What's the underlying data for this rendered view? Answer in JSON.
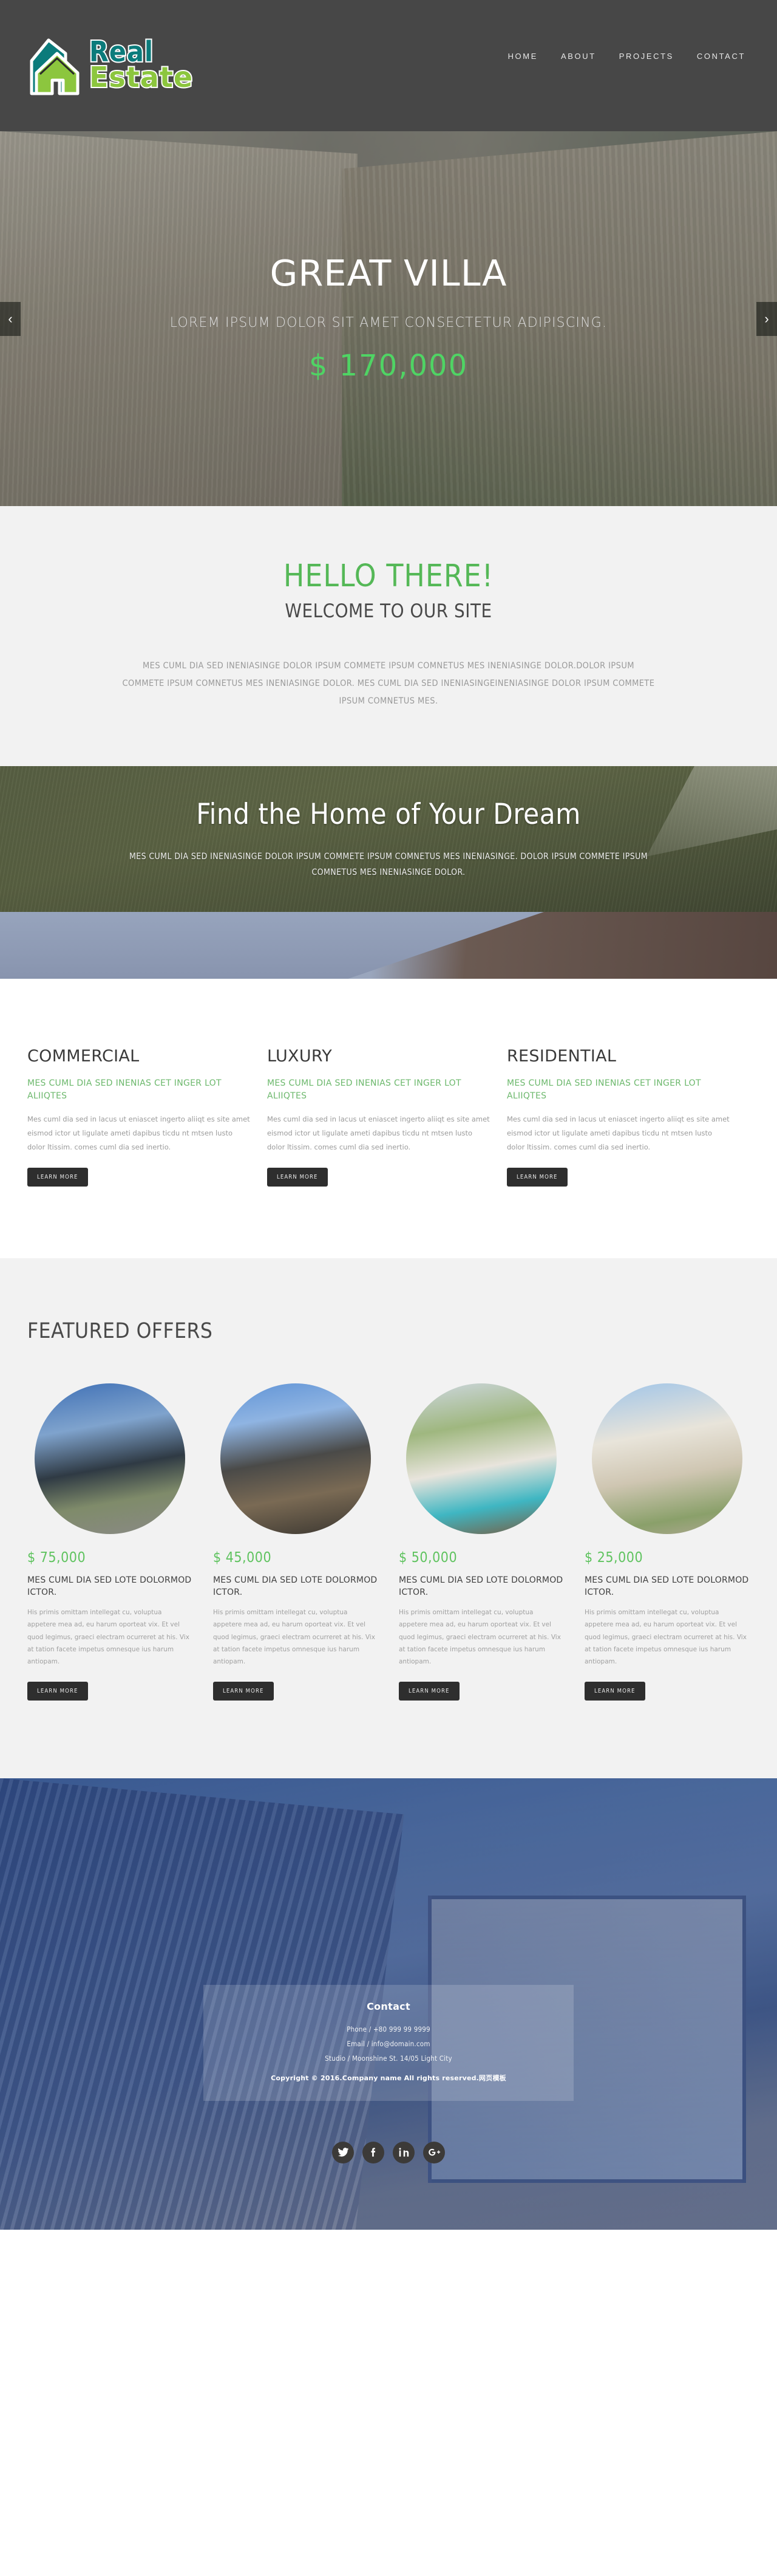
{
  "header": {
    "logo": {
      "line1": "Real",
      "line2": "Estate",
      "icon": "house-logo-icon",
      "color_teal": "#0b7b7b",
      "color_green": "#8cc63e"
    },
    "nav": [
      {
        "label": "HOME"
      },
      {
        "label": "ABOUT"
      },
      {
        "label": "PROJECTS"
      },
      {
        "label": "CONTACT"
      }
    ]
  },
  "hero": {
    "title": "GREAT VILLA",
    "subtitle": "LOREM IPSUM DOLOR SIT AMET CONSECTETUR ADIPISCING.",
    "price": "$ 170,000",
    "price_color": "#4fd464",
    "prev_label": "‹",
    "next_label": "›"
  },
  "hello": {
    "title": "HELLO THERE!",
    "subtitle": "WELCOME TO OUR SITE",
    "body": "MES CUML DIA SED INENIASINGE DOLOR IPSUM COMMETE IPSUM COMNETUS MES INENIASINGE DOLOR.DOLOR IPSUM COMMETE IPSUM COMNETUS MES INENIASINGE DOLOR. MES CUML DIA SED INENIASINGEINENIASINGE DOLOR IPSUM COMMETE IPSUM COMNETUS MES.",
    "title_color": "#55b857"
  },
  "parallax": {
    "title": "Find the Home of Your Dream",
    "body": "MES CUML DIA SED INENIASINGE DOLOR IPSUM COMMETE IPSUM COMNETUS MES INENIASINGE. DOLOR IPSUM COMMETE IPSUM COMNETUS MES INENIASINGE DOLOR."
  },
  "services": [
    {
      "title": "COMMERCIAL",
      "subtitle": "MES CUML DIA SED INENIAS CET INGER LOT ALIIQTES",
      "text": "Mes cuml dia sed in lacus ut eniascet ingerto aliiqt es site amet eismod ictor ut ligulate ameti dapibus ticdu nt mtsen lusto dolor ltissim. comes cuml dia sed inertio.",
      "button": "LEARN MORE"
    },
    {
      "title": "LUXURY",
      "subtitle": "MES CUML DIA SED INENIAS CET INGER LOT ALIIQTES",
      "text": "Mes cuml dia sed in lacus ut eniascet ingerto aliiqt es site amet eismod ictor ut ligulate ameti dapibus ticdu nt mtsen lusto dolor ltissim. comes cuml dia sed inertio.",
      "button": "LEARN MORE"
    },
    {
      "title": "RESIDENTIAL",
      "subtitle": "MES CUML DIA SED INENIAS CET INGER LOT ALIIQTES",
      "text": "Mes cuml dia sed in lacus ut eniascet ingerto aliiqt es site amet eismod ictor ut ligulate ameti dapibus ticdu nt mtsen lusto dolor ltissim. comes cuml dia sed inertio.",
      "button": "LEARN MORE"
    }
  ],
  "featured": {
    "title": "FEATURED OFFERS",
    "offers": [
      {
        "price": "$ 75,000",
        "name": "MES CUML DIA SED LOTE DOLORMOD ICTOR.",
        "text": "His primis omittam intellegat cu, voluptua appetere mea ad, eu harum oporteat vix. Et vel quod legimus, graeci electram ocurreret at his. Vix at tation facete impetus omnesque ius harum antiopam.",
        "button": "LEARN MORE",
        "image": "modern-glass-house-photo"
      },
      {
        "price": "$ 45,000",
        "name": "MES CUML DIA SED LOTE DOLORMOD ICTOR.",
        "text": "His primis omittam intellegat cu, voluptua appetere mea ad, eu harum oporteat vix. Et vel quod legimus, graeci electram ocurreret at his. Vix at tation facete impetus omnesque ius harum antiopam.",
        "button": "LEARN MORE",
        "image": "concrete-villa-dusk-photo"
      },
      {
        "price": "$ 50,000",
        "name": "MES CUML DIA SED LOTE DOLORMOD ICTOR.",
        "text": "His primis omittam intellegat cu, voluptua appetere mea ad, eu harum oporteat vix. Et vel quod legimus, graeci electram ocurreret at his. Vix at tation facete impetus omnesque ius harum antiopam.",
        "button": "LEARN MORE",
        "image": "pool-house-photo"
      },
      {
        "price": "$ 25,000",
        "name": "MES CUML DIA SED LOTE DOLORMOD ICTOR.",
        "text": "His primis omittam intellegat cu, voluptua appetere mea ad, eu harum oporteat vix. Et vel quod legimus, graeci electram ocurreret at his. Vix at tation facete impetus omnesque ius harum antiopam.",
        "button": "LEARN MORE",
        "image": "white-gabled-house-photo"
      }
    ],
    "price_color": "#5fc35f"
  },
  "footer": {
    "title": "Contact",
    "phone": "Phone / +80 999 99 9999",
    "email": "Email / info@domain.com",
    "studio": "Studio / Moonshine St. 14/05 Light City",
    "copyright": "Copyright © 2016.Company name All rights reserved.网页模板",
    "socials": [
      {
        "name": "twitter-icon",
        "glyph": "t"
      },
      {
        "name": "facebook-icon",
        "glyph": "f"
      },
      {
        "name": "linkedin-icon",
        "glyph": "in"
      },
      {
        "name": "googleplus-icon",
        "glyph": "G+"
      }
    ]
  }
}
